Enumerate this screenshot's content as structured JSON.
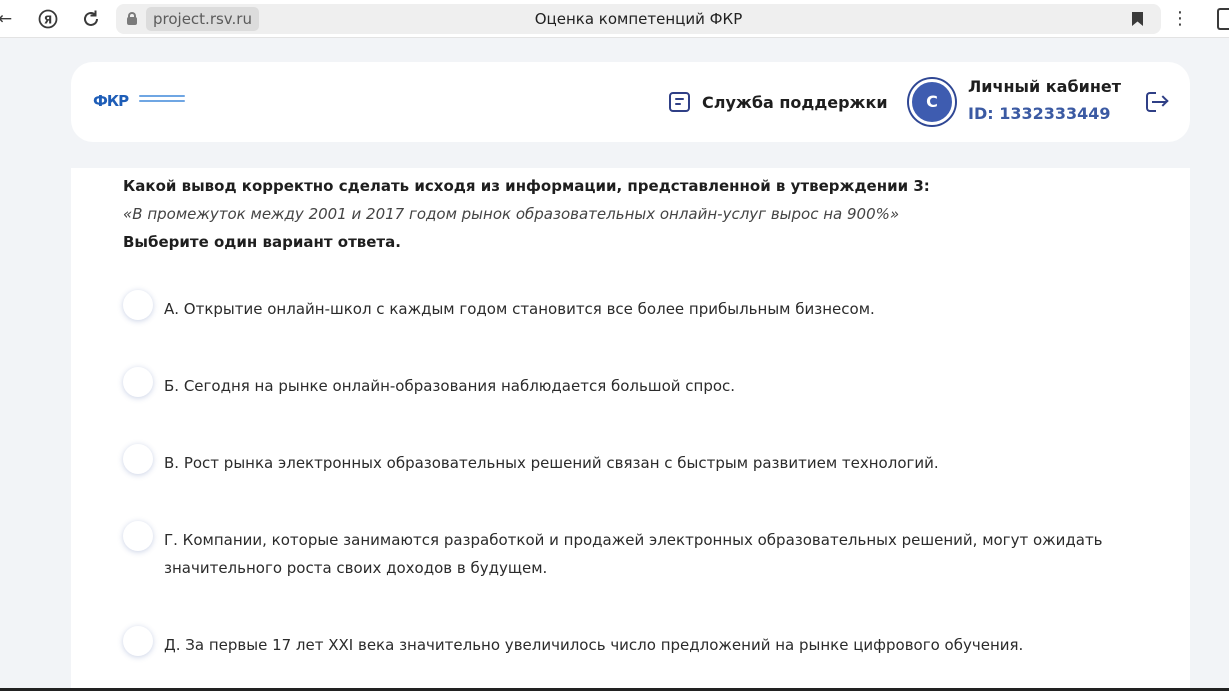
{
  "browser": {
    "domain": "project.rsv.ru",
    "tab_title": "Оценка компетенций ФКР",
    "menu_glyph": "⋮"
  },
  "header": {
    "logo_text": "ФКР",
    "support_label": "Служба поддержки",
    "avatar_letter": "С",
    "account_title": "Личный кабинет",
    "account_id": "ID: 1332333449"
  },
  "question": {
    "title": "Какой вывод корректно сделать исходя из информации, представленной в утверждении 3:",
    "quote": "«В промежуток между 2001 и 2017 годом рынок образовательных онлайн-услуг вырос на 900%»",
    "instruction": "Выберите один вариант ответа.",
    "options": [
      "А. Открытие онлайн-школ с каждым годом становится все более прибыльным бизнесом.",
      "Б. Сегодня на рынке онлайн-образования наблюдается большой спрос.",
      "В. Рост рынка электронных образовательных решений связан с быстрым развитием технологий.",
      "Г. Компании, которые занимаются разработкой и продажей электронных образовательных решений, могут ожидать значительного роста своих доходов в будущем.",
      "Д. За первые 17 лет XXI века значительно увеличилось число предложений на рынке цифрового обучения."
    ]
  },
  "colors": {
    "accent": "#3e5cb0",
    "id_text": "#3b5aa3",
    "icon": "#2f3f86",
    "page_bg": "#f2f4f7"
  }
}
